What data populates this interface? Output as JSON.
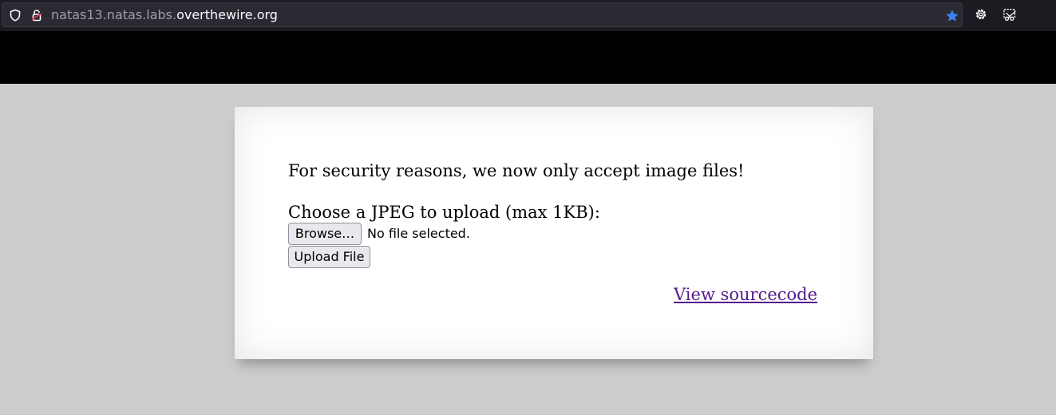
{
  "browser": {
    "url_subdomain": "natas13.natas.labs.",
    "url_domain": "overthewire.org",
    "icons": {
      "shield": "tracking-protection-shield-icon",
      "lock": "insecure-lock-icon",
      "star": "bookmark-star-icon",
      "gear": "settings-gear-icon",
      "extension": "screenshot-extension-icon"
    },
    "colors": {
      "star": "#3b82f6",
      "toolbar_bg": "#1c1b22",
      "urlbar_bg": "#2b2a33"
    }
  },
  "page": {
    "notice": "For security reasons, we now only accept image files!",
    "choose_label": "Choose a JPEG to upload (max 1KB):",
    "browse_label": "Browse…",
    "file_status": "No file selected.",
    "upload_label": "Upload File",
    "source_link": "View sourcecode",
    "colors": {
      "background": "#cccccc",
      "header": "#000000",
      "card": "#ffffff",
      "link_visited": "#551a8b"
    }
  }
}
